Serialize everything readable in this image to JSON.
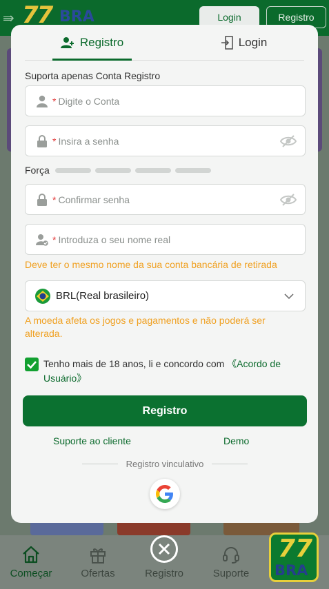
{
  "header": {
    "logo_text": "77",
    "logo_sub": "BRA",
    "login_button": "Login",
    "register_button": "Registro"
  },
  "modal": {
    "tabs": [
      {
        "label": "Registro",
        "active": true
      },
      {
        "label": "Login",
        "active": false
      }
    ],
    "account_section_label": "Suporta apenas Conta Registro",
    "required_mark": "*",
    "fields": {
      "account": {
        "placeholder": "Digite o Conta"
      },
      "password": {
        "placeholder": "Insira a senha"
      },
      "confirm_password": {
        "placeholder": "Confirmar senha"
      },
      "real_name": {
        "placeholder": "Introduza o seu nome real"
      }
    },
    "strength_label": "Força",
    "real_name_hint": "Deve ter o mesmo nome da sua conta bancária de retirada",
    "currency": {
      "selected": "BRL(Real brasileiro)"
    },
    "currency_hint": "A moeda afeta os jogos e pagamentos e não poderá ser alterada.",
    "terms": {
      "text": "Tenho mais de 18 anos, li e concordo com ",
      "link": "《Acordo de Usuário》",
      "checked": true
    },
    "submit_button": "Registro",
    "support_link": "Suporte ao cliente",
    "demo_link": "Demo",
    "divider_text": "Registro vinculativo"
  },
  "bottom_nav": {
    "items": [
      {
        "label": "Começar",
        "active": true
      },
      {
        "label": "Ofertas",
        "active": false
      },
      {
        "label": "Registro",
        "active": false
      },
      {
        "label": "Suporte",
        "active": false
      }
    ]
  },
  "colors": {
    "brand_green": "#0b6a2c",
    "hint_orange": "#f0a020",
    "required_red": "#e23c3c",
    "checkbox_green": "#12a030"
  }
}
